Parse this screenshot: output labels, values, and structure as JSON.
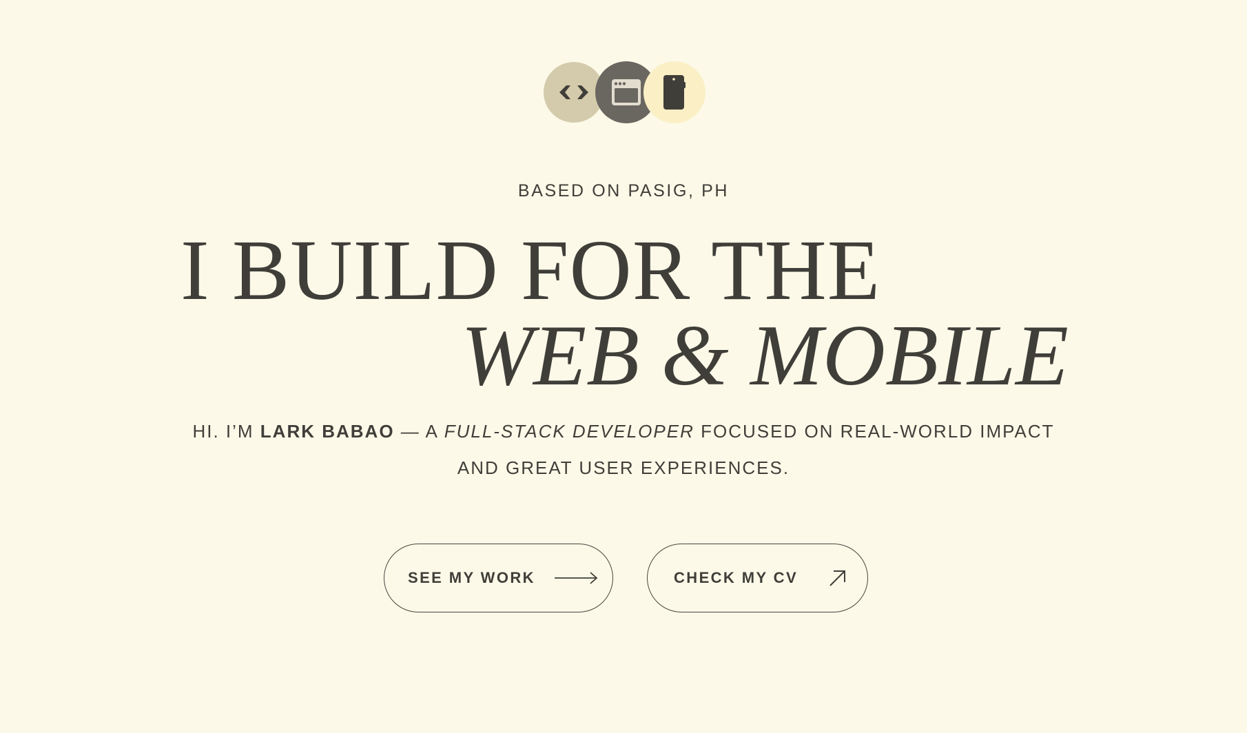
{
  "hero": {
    "location": "BASED ON PASIG, PH",
    "headline_line1": "I BUILD FOR THE",
    "headline_line2": "WEB & MOBILE",
    "intro": {
      "prefix": "HI. I’M ",
      "name": "LARK BABAO",
      "middle": " — A ",
      "role": "FULL-STACK DEVELOPER",
      "suffix": " FOCUSED ON REAL-WORLD IMPACT AND GREAT USER EXPERIENCES."
    }
  },
  "icons": [
    "code-icon",
    "browser-window-icon",
    "mobile-phone-icon"
  ],
  "buttons": {
    "work_label": "SEE MY WORK",
    "cv_label": "CHECK MY CV"
  },
  "colors": {
    "background": "#fcf9e8",
    "text": "#403e39",
    "icon_code_bg": "#d3cbab",
    "icon_browser_bg": "#6a6660",
    "icon_phone_bg": "#fbefc6"
  }
}
